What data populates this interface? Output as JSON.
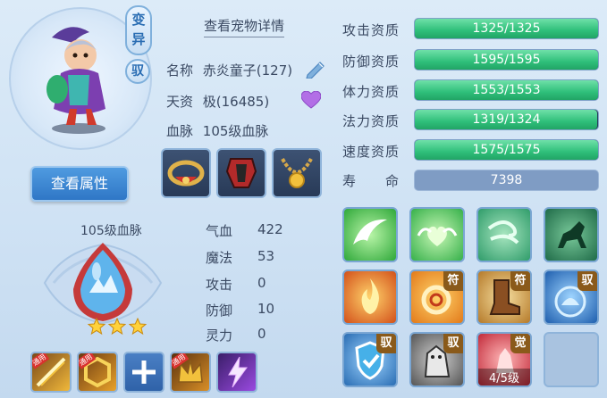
{
  "badges": {
    "mutate": "变异",
    "tame": "驭"
  },
  "header": {
    "detail_link": "查看宠物详情"
  },
  "info": {
    "name_label": "名称",
    "name_value": "赤炎童子(127)",
    "aptitude_label": "天资",
    "aptitude_value": "极(16485)",
    "blood_label": "血脉",
    "blood_value": "105级血脉"
  },
  "buttons": {
    "view_attributes": "查看属性"
  },
  "aptitudes": [
    {
      "label": "攻击资质",
      "text": "1325/1325",
      "fill": 1.0
    },
    {
      "label": "防御资质",
      "text": "1595/1595",
      "fill": 1.0
    },
    {
      "label": "体力资质",
      "text": "1553/1553",
      "fill": 1.0
    },
    {
      "label": "法力资质",
      "text": "1319/1324",
      "fill": 0.996
    },
    {
      "label": "速度资质",
      "text": "1575/1575",
      "fill": 1.0
    }
  ],
  "life": {
    "label": "寿　　命",
    "value": "7398"
  },
  "bloodline": {
    "title": "105级血脉",
    "stars": 3
  },
  "stats": [
    {
      "label": "气血",
      "value": "422"
    },
    {
      "label": "魔法",
      "value": "53"
    },
    {
      "label": "攻击",
      "value": "0"
    },
    {
      "label": "防御",
      "value": "10"
    },
    {
      "label": "灵力",
      "value": "0"
    }
  ],
  "small_skills": {
    "tag": "通用"
  },
  "skills": {
    "tag_fu": "符",
    "tag_yu": "驭",
    "tag_jue": "觉",
    "level_text": "4/5级"
  },
  "colors": {
    "bar_fill": "#2fbf7a",
    "accent_blue": "#2f77c6"
  }
}
